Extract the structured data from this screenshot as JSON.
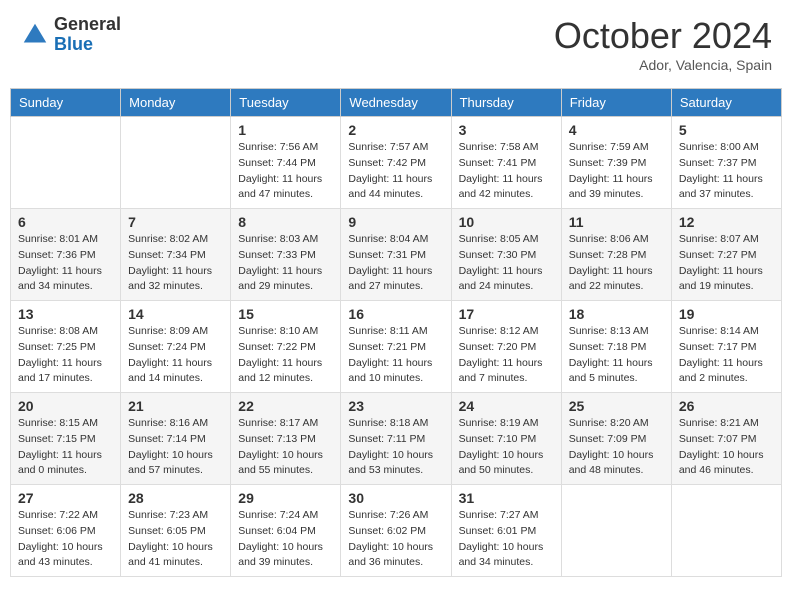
{
  "logo": {
    "general": "General",
    "blue": "Blue"
  },
  "title": {
    "month_year": "October 2024",
    "location": "Ador, Valencia, Spain"
  },
  "weekdays": [
    "Sunday",
    "Monday",
    "Tuesday",
    "Wednesday",
    "Thursday",
    "Friday",
    "Saturday"
  ],
  "weeks": [
    [
      {
        "day": "",
        "sunrise": "",
        "sunset": "",
        "daylight": ""
      },
      {
        "day": "",
        "sunrise": "",
        "sunset": "",
        "daylight": ""
      },
      {
        "day": "1",
        "sunrise": "Sunrise: 7:56 AM",
        "sunset": "Sunset: 7:44 PM",
        "daylight": "Daylight: 11 hours and 47 minutes."
      },
      {
        "day": "2",
        "sunrise": "Sunrise: 7:57 AM",
        "sunset": "Sunset: 7:42 PM",
        "daylight": "Daylight: 11 hours and 44 minutes."
      },
      {
        "day": "3",
        "sunrise": "Sunrise: 7:58 AM",
        "sunset": "Sunset: 7:41 PM",
        "daylight": "Daylight: 11 hours and 42 minutes."
      },
      {
        "day": "4",
        "sunrise": "Sunrise: 7:59 AM",
        "sunset": "Sunset: 7:39 PM",
        "daylight": "Daylight: 11 hours and 39 minutes."
      },
      {
        "day": "5",
        "sunrise": "Sunrise: 8:00 AM",
        "sunset": "Sunset: 7:37 PM",
        "daylight": "Daylight: 11 hours and 37 minutes."
      }
    ],
    [
      {
        "day": "6",
        "sunrise": "Sunrise: 8:01 AM",
        "sunset": "Sunset: 7:36 PM",
        "daylight": "Daylight: 11 hours and 34 minutes."
      },
      {
        "day": "7",
        "sunrise": "Sunrise: 8:02 AM",
        "sunset": "Sunset: 7:34 PM",
        "daylight": "Daylight: 11 hours and 32 minutes."
      },
      {
        "day": "8",
        "sunrise": "Sunrise: 8:03 AM",
        "sunset": "Sunset: 7:33 PM",
        "daylight": "Daylight: 11 hours and 29 minutes."
      },
      {
        "day": "9",
        "sunrise": "Sunrise: 8:04 AM",
        "sunset": "Sunset: 7:31 PM",
        "daylight": "Daylight: 11 hours and 27 minutes."
      },
      {
        "day": "10",
        "sunrise": "Sunrise: 8:05 AM",
        "sunset": "Sunset: 7:30 PM",
        "daylight": "Daylight: 11 hours and 24 minutes."
      },
      {
        "day": "11",
        "sunrise": "Sunrise: 8:06 AM",
        "sunset": "Sunset: 7:28 PM",
        "daylight": "Daylight: 11 hours and 22 minutes."
      },
      {
        "day": "12",
        "sunrise": "Sunrise: 8:07 AM",
        "sunset": "Sunset: 7:27 PM",
        "daylight": "Daylight: 11 hours and 19 minutes."
      }
    ],
    [
      {
        "day": "13",
        "sunrise": "Sunrise: 8:08 AM",
        "sunset": "Sunset: 7:25 PM",
        "daylight": "Daylight: 11 hours and 17 minutes."
      },
      {
        "day": "14",
        "sunrise": "Sunrise: 8:09 AM",
        "sunset": "Sunset: 7:24 PM",
        "daylight": "Daylight: 11 hours and 14 minutes."
      },
      {
        "day": "15",
        "sunrise": "Sunrise: 8:10 AM",
        "sunset": "Sunset: 7:22 PM",
        "daylight": "Daylight: 11 hours and 12 minutes."
      },
      {
        "day": "16",
        "sunrise": "Sunrise: 8:11 AM",
        "sunset": "Sunset: 7:21 PM",
        "daylight": "Daylight: 11 hours and 10 minutes."
      },
      {
        "day": "17",
        "sunrise": "Sunrise: 8:12 AM",
        "sunset": "Sunset: 7:20 PM",
        "daylight": "Daylight: 11 hours and 7 minutes."
      },
      {
        "day": "18",
        "sunrise": "Sunrise: 8:13 AM",
        "sunset": "Sunset: 7:18 PM",
        "daylight": "Daylight: 11 hours and 5 minutes."
      },
      {
        "day": "19",
        "sunrise": "Sunrise: 8:14 AM",
        "sunset": "Sunset: 7:17 PM",
        "daylight": "Daylight: 11 hours and 2 minutes."
      }
    ],
    [
      {
        "day": "20",
        "sunrise": "Sunrise: 8:15 AM",
        "sunset": "Sunset: 7:15 PM",
        "daylight": "Daylight: 11 hours and 0 minutes."
      },
      {
        "day": "21",
        "sunrise": "Sunrise: 8:16 AM",
        "sunset": "Sunset: 7:14 PM",
        "daylight": "Daylight: 10 hours and 57 minutes."
      },
      {
        "day": "22",
        "sunrise": "Sunrise: 8:17 AM",
        "sunset": "Sunset: 7:13 PM",
        "daylight": "Daylight: 10 hours and 55 minutes."
      },
      {
        "day": "23",
        "sunrise": "Sunrise: 8:18 AM",
        "sunset": "Sunset: 7:11 PM",
        "daylight": "Daylight: 10 hours and 53 minutes."
      },
      {
        "day": "24",
        "sunrise": "Sunrise: 8:19 AM",
        "sunset": "Sunset: 7:10 PM",
        "daylight": "Daylight: 10 hours and 50 minutes."
      },
      {
        "day": "25",
        "sunrise": "Sunrise: 8:20 AM",
        "sunset": "Sunset: 7:09 PM",
        "daylight": "Daylight: 10 hours and 48 minutes."
      },
      {
        "day": "26",
        "sunrise": "Sunrise: 8:21 AM",
        "sunset": "Sunset: 7:07 PM",
        "daylight": "Daylight: 10 hours and 46 minutes."
      }
    ],
    [
      {
        "day": "27",
        "sunrise": "Sunrise: 7:22 AM",
        "sunset": "Sunset: 6:06 PM",
        "daylight": "Daylight: 10 hours and 43 minutes."
      },
      {
        "day": "28",
        "sunrise": "Sunrise: 7:23 AM",
        "sunset": "Sunset: 6:05 PM",
        "daylight": "Daylight: 10 hours and 41 minutes."
      },
      {
        "day": "29",
        "sunrise": "Sunrise: 7:24 AM",
        "sunset": "Sunset: 6:04 PM",
        "daylight": "Daylight: 10 hours and 39 minutes."
      },
      {
        "day": "30",
        "sunrise": "Sunrise: 7:26 AM",
        "sunset": "Sunset: 6:02 PM",
        "daylight": "Daylight: 10 hours and 36 minutes."
      },
      {
        "day": "31",
        "sunrise": "Sunrise: 7:27 AM",
        "sunset": "Sunset: 6:01 PM",
        "daylight": "Daylight: 10 hours and 34 minutes."
      },
      {
        "day": "",
        "sunrise": "",
        "sunset": "",
        "daylight": ""
      },
      {
        "day": "",
        "sunrise": "",
        "sunset": "",
        "daylight": ""
      }
    ]
  ]
}
